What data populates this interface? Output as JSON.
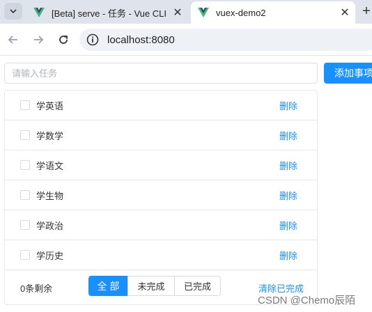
{
  "browser": {
    "tabs": [
      {
        "title": "[Beta] serve - 任务 - Vue CLI",
        "active": false
      },
      {
        "title": "vuex-demo2",
        "active": true
      }
    ],
    "url": "localhost:8080",
    "icons": {
      "dropdown": "chevron-down-icon",
      "back": "back-arrow-icon",
      "forward": "forward-arrow-icon",
      "reload": "reload-icon",
      "site_info": "info-icon",
      "favicon": "vue-logo-icon",
      "close": "close-icon",
      "new_tab": "plus-icon"
    }
  },
  "app": {
    "input": {
      "placeholder": "请输入任务",
      "value": ""
    },
    "add_button": "添加事项",
    "tasks": [
      {
        "label": "学英语",
        "done": false,
        "delete_label": "删除"
      },
      {
        "label": "学数学",
        "done": false,
        "delete_label": "删除"
      },
      {
        "label": "学语文",
        "done": false,
        "delete_label": "删除"
      },
      {
        "label": "学生物",
        "done": false,
        "delete_label": "删除"
      },
      {
        "label": "学政治",
        "done": false,
        "delete_label": "删除"
      },
      {
        "label": "学历史",
        "done": false,
        "delete_label": "删除"
      }
    ],
    "footer": {
      "remaining": "0条剩余",
      "filters": {
        "all": "全 部",
        "active": "未完成",
        "done": "已完成"
      },
      "selected_filter": "all",
      "clear": "清除已完成"
    }
  },
  "watermark": "CSDN @Chemo辰陌",
  "colors": {
    "primary": "#1890ff",
    "tabstrip": "#dfe3eb",
    "vue_green": "#41b883",
    "vue_dark": "#34495e"
  }
}
